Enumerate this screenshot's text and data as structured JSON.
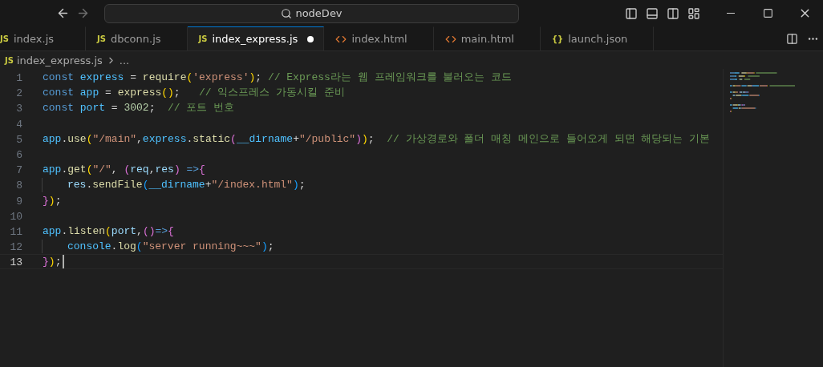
{
  "title_bar": {
    "search": "nodeDev"
  },
  "tabs": [
    {
      "label": "index.js",
      "kind": "js",
      "badge": "JS",
      "selected": false,
      "modified": false
    },
    {
      "label": "dbconn.js",
      "kind": "js",
      "badge": "JS",
      "selected": false,
      "modified": false
    },
    {
      "label": "index_express.js",
      "kind": "js",
      "badge": "JS",
      "selected": true,
      "modified": true
    },
    {
      "label": "index.html",
      "kind": "html",
      "selected": false,
      "modified": false
    },
    {
      "label": "main.html",
      "kind": "html",
      "selected": false,
      "modified": false
    },
    {
      "label": "launch.json",
      "kind": "json",
      "badge": "{}",
      "selected": false,
      "modified": false
    }
  ],
  "breadcrumbs": {
    "badge": "JS",
    "file": "index_express.js",
    "rest": "..."
  },
  "code": {
    "lines": [
      {
        "number": "1",
        "current": false,
        "indent": false,
        "tokens": [
          {
            "kind": "kw",
            "text": "const "
          },
          {
            "kind": "const",
            "text": "express"
          },
          {
            "kind": "p",
            "text": " = "
          },
          {
            "kind": "fn",
            "text": "require"
          },
          {
            "kind": "b1",
            "text": "("
          },
          {
            "kind": "str",
            "text": "'express'"
          },
          {
            "kind": "b1",
            "text": ")"
          },
          {
            "kind": "p",
            "text": "; "
          },
          {
            "kind": "cm",
            "text": "// Express라는 웹 프레임워크를 불러오는 코드"
          }
        ]
      },
      {
        "number": "2",
        "current": false,
        "indent": false,
        "tokens": [
          {
            "kind": "kw",
            "text": "const "
          },
          {
            "kind": "const",
            "text": "app"
          },
          {
            "kind": "p",
            "text": " = "
          },
          {
            "kind": "fn",
            "text": "express"
          },
          {
            "kind": "b1",
            "text": "()"
          },
          {
            "kind": "p",
            "text": ";   "
          },
          {
            "kind": "cm",
            "text": "// 익스프레스 가동시킬 준비"
          }
        ]
      },
      {
        "number": "3",
        "current": false,
        "indent": false,
        "tokens": [
          {
            "kind": "kw",
            "text": "const "
          },
          {
            "kind": "const",
            "text": "port"
          },
          {
            "kind": "p",
            "text": " = "
          },
          {
            "kind": "num",
            "text": "3002"
          },
          {
            "kind": "p",
            "text": ";  "
          },
          {
            "kind": "cm",
            "text": "// 포트 번호"
          }
        ]
      },
      {
        "number": "4",
        "current": false,
        "indent": false
      },
      {
        "number": "5",
        "current": false,
        "indent": false,
        "tokens": [
          {
            "kind": "const",
            "text": "app"
          },
          {
            "kind": "p",
            "text": "."
          },
          {
            "kind": "fn",
            "text": "use"
          },
          {
            "kind": "b1",
            "text": "("
          },
          {
            "kind": "str",
            "text": "\"/main\""
          },
          {
            "kind": "p",
            "text": ","
          },
          {
            "kind": "const",
            "text": "express"
          },
          {
            "kind": "p",
            "text": "."
          },
          {
            "kind": "fn",
            "text": "static"
          },
          {
            "kind": "b2",
            "text": "("
          },
          {
            "kind": "const",
            "text": "__dirname"
          },
          {
            "kind": "p",
            "text": "+"
          },
          {
            "kind": "str",
            "text": "\"/public\""
          },
          {
            "kind": "b2",
            "text": ")"
          },
          {
            "kind": "b1",
            "text": ")"
          },
          {
            "kind": "p",
            "text": ";  "
          },
          {
            "kind": "cm",
            "text": "// 가상경로와 폴더 매칭 메인으로 들어오게 되면 해당되는 기본"
          }
        ]
      },
      {
        "number": "6",
        "current": false,
        "indent": false
      },
      {
        "number": "7",
        "current": false,
        "indent": false,
        "tokens": [
          {
            "kind": "const",
            "text": "app"
          },
          {
            "kind": "p",
            "text": "."
          },
          {
            "kind": "fn",
            "text": "get"
          },
          {
            "kind": "b1",
            "text": "("
          },
          {
            "kind": "str",
            "text": "\"/\""
          },
          {
            "kind": "p",
            "text": ", "
          },
          {
            "kind": "b2",
            "text": "("
          },
          {
            "kind": "var",
            "text": "req"
          },
          {
            "kind": "p",
            "text": ","
          },
          {
            "kind": "var",
            "text": "res"
          },
          {
            "kind": "b2",
            "text": ")"
          },
          {
            "kind": "kw",
            "text": " =>"
          },
          {
            "kind": "b2",
            "text": "{"
          }
        ]
      },
      {
        "number": "8",
        "current": false,
        "indent": true,
        "tokens": [
          {
            "kind": "var",
            "text": "res"
          },
          {
            "kind": "p",
            "text": "."
          },
          {
            "kind": "fn",
            "text": "sendFile"
          },
          {
            "kind": "b3",
            "text": "("
          },
          {
            "kind": "const",
            "text": "__dirname"
          },
          {
            "kind": "p",
            "text": "+"
          },
          {
            "kind": "str",
            "text": "\"/index.html\""
          },
          {
            "kind": "b3",
            "text": ")"
          },
          {
            "kind": "p",
            "text": ";"
          }
        ]
      },
      {
        "number": "9",
        "current": false,
        "indent": false,
        "tokens": [
          {
            "kind": "b2",
            "text": "}"
          },
          {
            "kind": "b1",
            "text": ")"
          },
          {
            "kind": "p",
            "text": ";"
          }
        ]
      },
      {
        "number": "10",
        "current": false,
        "indent": false
      },
      {
        "number": "11",
        "current": false,
        "indent": false,
        "tokens": [
          {
            "kind": "const",
            "text": "app"
          },
          {
            "kind": "p",
            "text": "."
          },
          {
            "kind": "fn",
            "text": "listen"
          },
          {
            "kind": "b1",
            "text": "("
          },
          {
            "kind": "var",
            "text": "port"
          },
          {
            "kind": "p",
            "text": ","
          },
          {
            "kind": "b2",
            "text": "()"
          },
          {
            "kind": "kw",
            "text": "=>"
          },
          {
            "kind": "b2",
            "text": "{"
          }
        ]
      },
      {
        "number": "12",
        "current": false,
        "indent": true,
        "tokens": [
          {
            "kind": "const",
            "text": "console"
          },
          {
            "kind": "p",
            "text": "."
          },
          {
            "kind": "fn",
            "text": "log"
          },
          {
            "kind": "b3",
            "text": "("
          },
          {
            "kind": "str",
            "text": "\"server running~~~\""
          },
          {
            "kind": "b3",
            "text": ")"
          },
          {
            "kind": "p",
            "text": ";"
          }
        ]
      },
      {
        "number": "13",
        "current": true,
        "indent": false,
        "tokens": [
          {
            "kind": "b2",
            "text": "}"
          },
          {
            "kind": "b1",
            "text": ")"
          },
          {
            "kind": "p",
            "text": ";"
          }
        ]
      }
    ]
  }
}
